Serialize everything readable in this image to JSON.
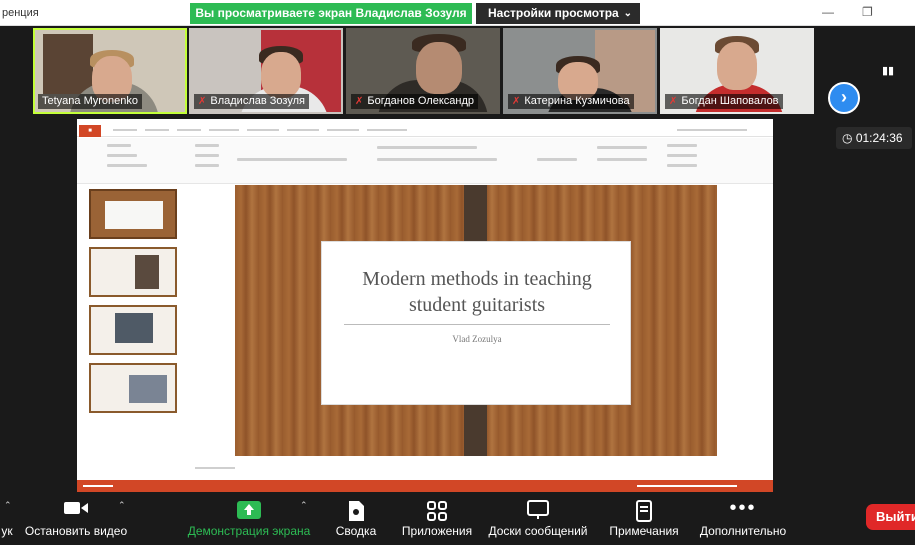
{
  "window": {
    "title": "ренция"
  },
  "share_banner": "Вы просматриваете экран Владислав Зозуля",
  "view_settings": {
    "label": "Настройки просмотра"
  },
  "participants": [
    {
      "name": "Tetyana Myronenko",
      "muted": false
    },
    {
      "name": "Владислав Зозуля",
      "muted": true
    },
    {
      "name": "Богданов Олександр",
      "muted": true
    },
    {
      "name": "Катерина Кузмичова",
      "muted": true
    },
    {
      "name": "Богдан Шаповалов",
      "muted": true
    }
  ],
  "timer": "01:24:36",
  "slide": {
    "title_line1": "Modern methods in teaching",
    "title_line2": "student guitarists",
    "author": "Vlad Zozulya"
  },
  "toolbar": {
    "audio_label": "ук",
    "video_label": "Остановить видео",
    "share_label": "Демонстрация экрана",
    "summary_label": "Сводка",
    "apps_label": "Приложения",
    "whiteboards_label": "Доски сообщений",
    "notes_label": "Примечания",
    "more_label": "Дополнительно",
    "leave_label": "Выйти"
  },
  "colors": {
    "share_green": "#2dbb54",
    "active_speaker": "#c4ff3a",
    "leave_red": "#e02828",
    "ppt_orange": "#d24726"
  }
}
